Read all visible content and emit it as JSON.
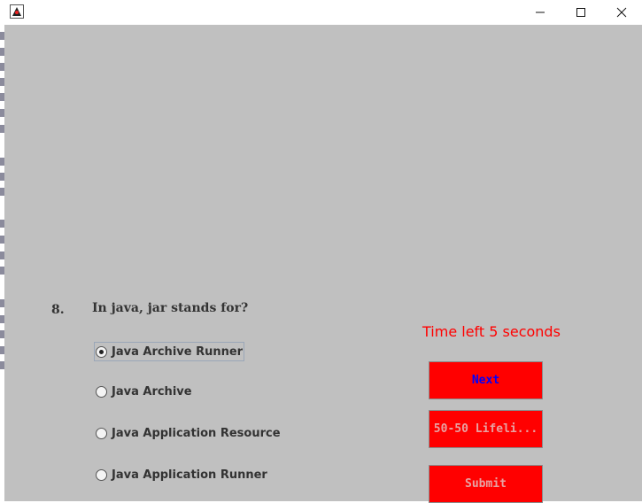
{
  "window": {
    "app_icon": "java-duke-icon",
    "controls": [
      "minimize-icon",
      "maximize-icon",
      "close-icon"
    ]
  },
  "question": {
    "number": "8.",
    "text": "In java, jar stands for?"
  },
  "options": [
    {
      "label": "Java Archive Runner",
      "selected": true
    },
    {
      "label": "Java Archive",
      "selected": false
    },
    {
      "label": "Java Application Resource",
      "selected": false
    },
    {
      "label": "Java Application Runner",
      "selected": false
    }
  ],
  "timer": {
    "text": "Time left 5 seconds",
    "color": "#ff0000"
  },
  "buttons": {
    "next": {
      "label": "Next",
      "color": "#0000ff",
      "bg": "#ff0000"
    },
    "lifeline": {
      "label": "50-50 Lifeli...",
      "color": "#e7a3a3",
      "bg": "#ff0000"
    },
    "submit": {
      "label": "Submit",
      "color": "#e7a3a3",
      "bg": "#ff0000"
    }
  },
  "colors": {
    "panel_bg": "#c0c0c0",
    "text": "#333333"
  }
}
